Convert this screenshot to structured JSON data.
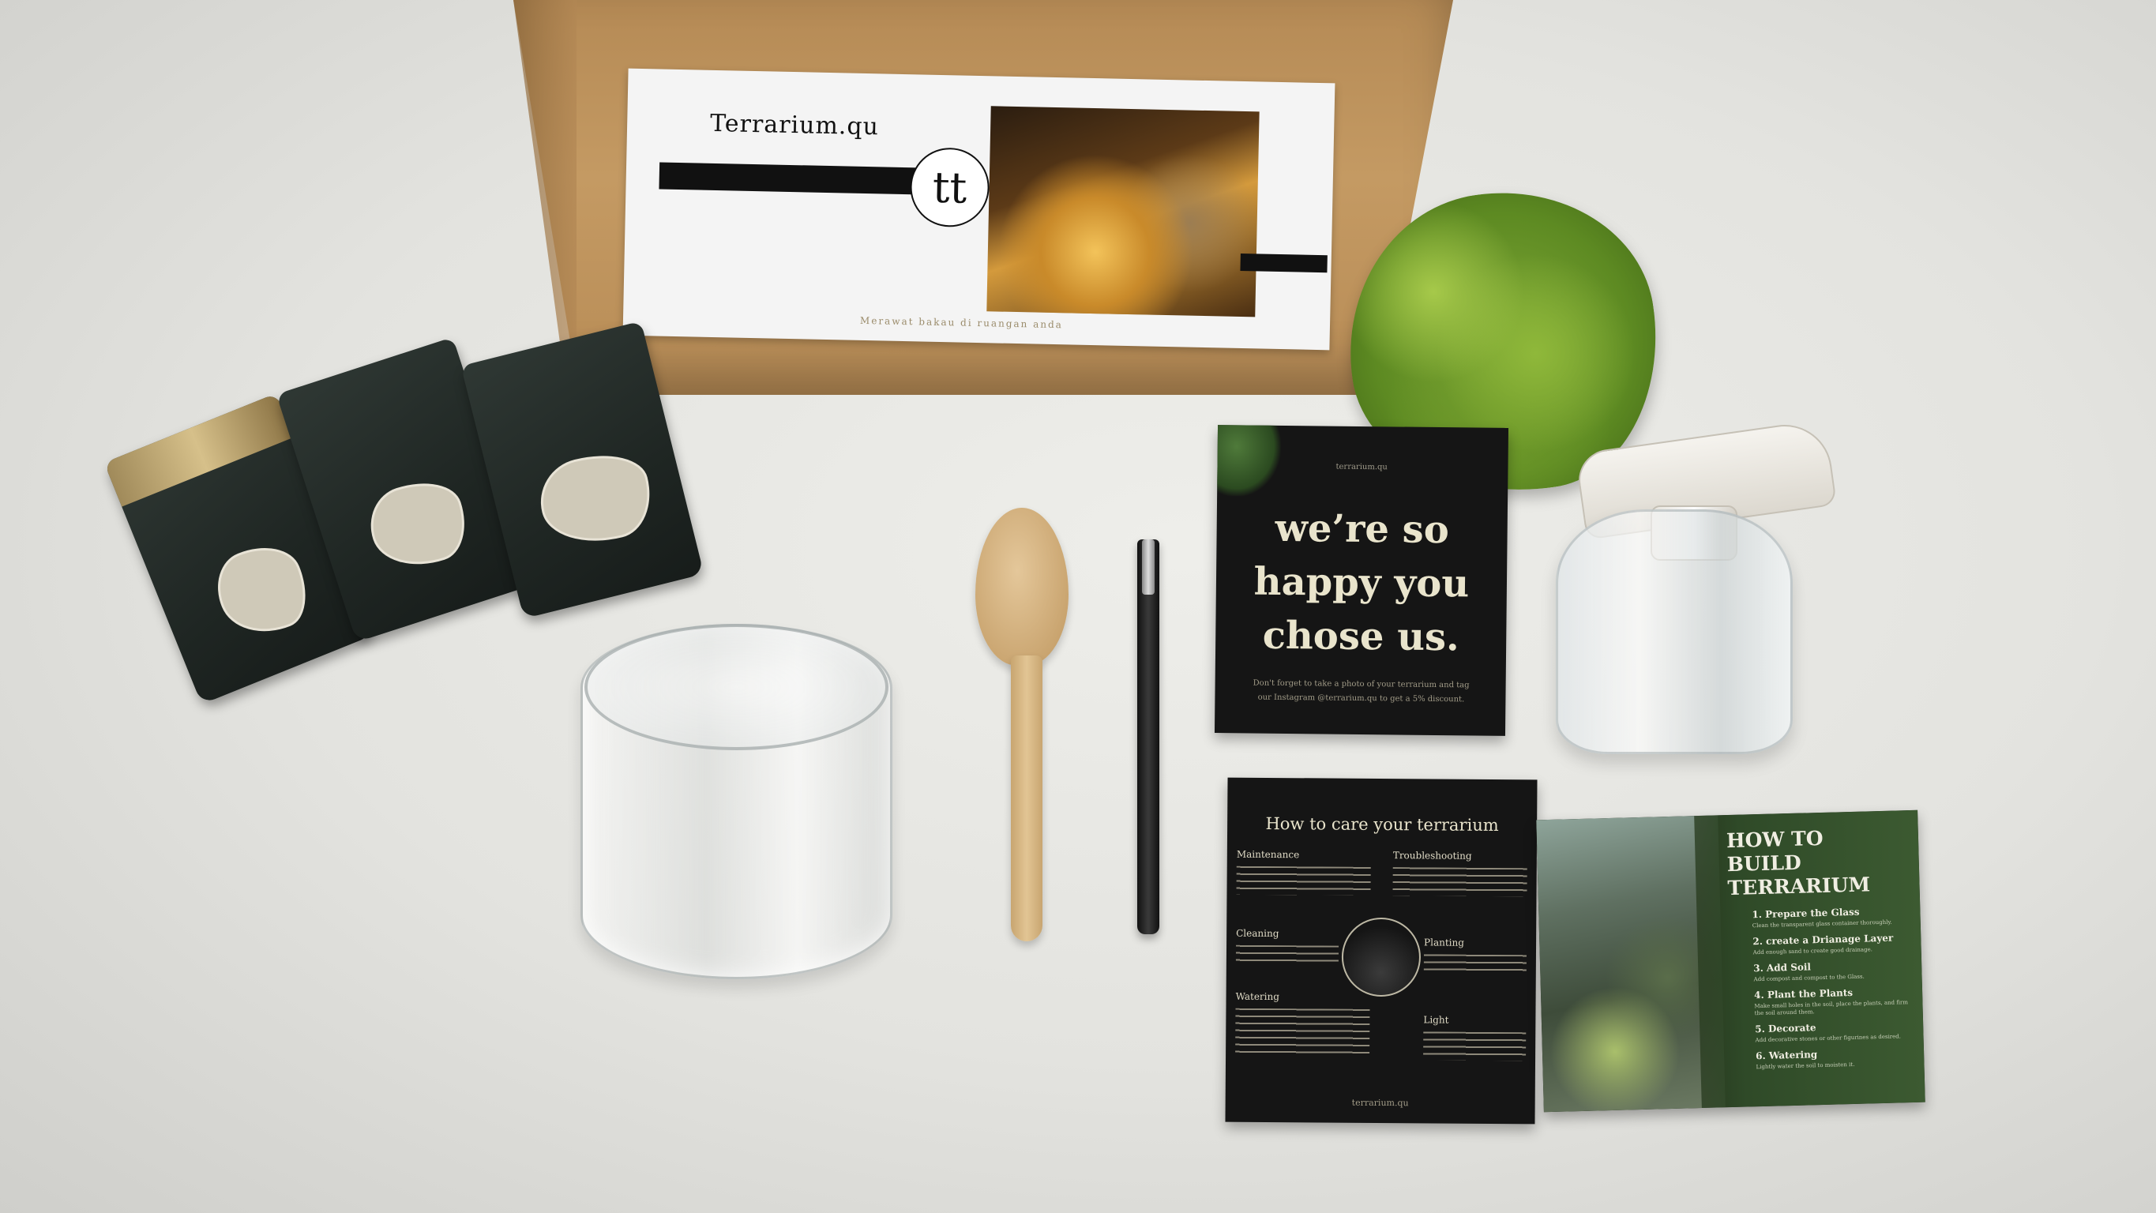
{
  "box_label": {
    "brand": "Terrarium.qu",
    "logo": "tt",
    "tagline": "Merawat bakau di ruangan anda"
  },
  "card_thanks": {
    "small_text": "terrarium.qu",
    "headline_1": "we’re so",
    "headline_2": "happy you",
    "headline_3": "chose us.",
    "body": "Don't forget to take a photo of your terrarium and tag our Instagram @terrarium.qu to get a 5% discount."
  },
  "card_care": {
    "title": "How to care your terrarium",
    "sections": {
      "maintenance": "Maintenance",
      "troubleshooting": "Troubleshooting",
      "cleaning": "Cleaning",
      "planting": "Planting",
      "watering": "Watering",
      "light": "Light"
    },
    "footer": "terrarium.qu"
  },
  "card_howto": {
    "title_1": "HOW TO",
    "title_2": "BUILD",
    "title_3": "TERRARIUM",
    "steps": [
      {
        "label": "1. Prepare the Glass",
        "sub": "Clean the transparent glass container thoroughly."
      },
      {
        "label": "2. create a Drianage Layer",
        "sub": "Add enough sand to create good drainage."
      },
      {
        "label": "3. Add Soil",
        "sub": "Add compost and compost to the Glass."
      },
      {
        "label": "4. Plant the Plants",
        "sub": "Make small holes in the soil, place the plants, and firm the soil around them."
      },
      {
        "label": "5. Decorate",
        "sub": "Add decorative stones or other figurines as desired."
      },
      {
        "label": "6. Watering",
        "sub": "Lightly water the soil to moisten it."
      }
    ]
  }
}
